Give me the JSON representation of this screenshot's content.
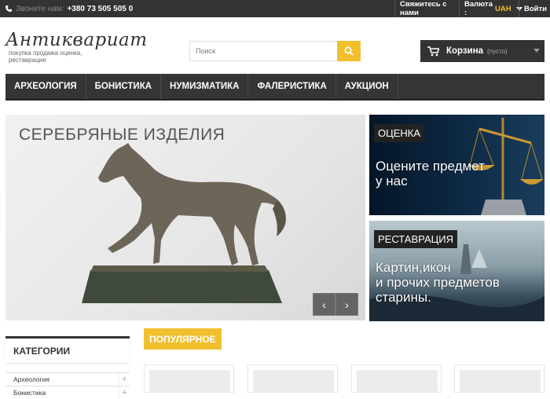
{
  "topbar": {
    "phone_label": "Звоните нам:",
    "phone_number": "+380 73 505 505 0",
    "contact": "Свяжитесь с нами",
    "currency_label": "Валюта :",
    "currency_value": "UAH",
    "login": "Войти"
  },
  "logo": {
    "title": "Антиквариат",
    "subtitle": "покупка продажа оценка, реставрация"
  },
  "search": {
    "placeholder": "Поиск"
  },
  "cart": {
    "label": "Корзина",
    "status": "(пусто)"
  },
  "menu": {
    "items": [
      {
        "label": "АРХЕОЛОГИЯ"
      },
      {
        "label": "БОНИСТИКА"
      },
      {
        "label": "НУМИЗМАТИКА"
      },
      {
        "label": "ФАЛЕРИСТИКА"
      },
      {
        "label": "АУКЦИОН"
      }
    ]
  },
  "slider": {
    "title": "СЕРЕБРЯНЫЕ ИЗДЕЛИЯ"
  },
  "banners": [
    {
      "tag": "ОЦЕНКА",
      "text_line1": "Оцените предмет",
      "text_line2": "у нас"
    },
    {
      "tag": "РЕСТАВРАЦИЯ",
      "text_line1": "Картин,икон",
      "text_line2": "и прочих предметов",
      "text_line3": "старины."
    }
  ],
  "sidebar": {
    "title": "КАТЕГОРИИ",
    "items": [
      {
        "label": "Археология"
      },
      {
        "label": "Бонистика"
      }
    ]
  },
  "popular": {
    "label": "ПОПУЛЯРНОЕ"
  },
  "colors": {
    "accent": "#f1c02f",
    "dark": "#333333"
  }
}
